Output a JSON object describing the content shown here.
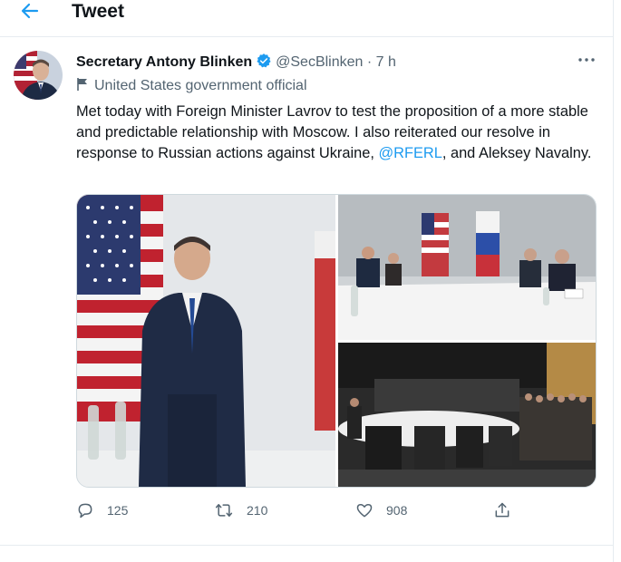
{
  "header": {
    "title": "Tweet"
  },
  "author": {
    "name": "Secretary Antony Blinken",
    "handle": "@SecBlinken",
    "separator": "·",
    "time": "7 h",
    "affiliation": "United States government official"
  },
  "tweet": {
    "text_part1": "Met today with Foreign Minister Lavrov to test the proposition of a more stable and predictable relationship with Moscow. I also reiterated our resolve in response to Russian actions against Ukraine, ",
    "mention": "@RFERL",
    "text_part2": ", and Aleksey Navalny."
  },
  "actions": {
    "replies": "125",
    "retweets": "210",
    "likes": "908"
  },
  "icons": {
    "back": "arrow-left-icon",
    "verified": "verified-badge-icon",
    "more": "more-dots-icon",
    "affiliation": "flag-icon",
    "reply": "reply-icon",
    "retweet": "retweet-icon",
    "like": "heart-icon",
    "share": "share-icon"
  },
  "colors": {
    "accent": "#1d9bf0",
    "secondary_text": "#536471",
    "border": "#e6ecf0"
  }
}
